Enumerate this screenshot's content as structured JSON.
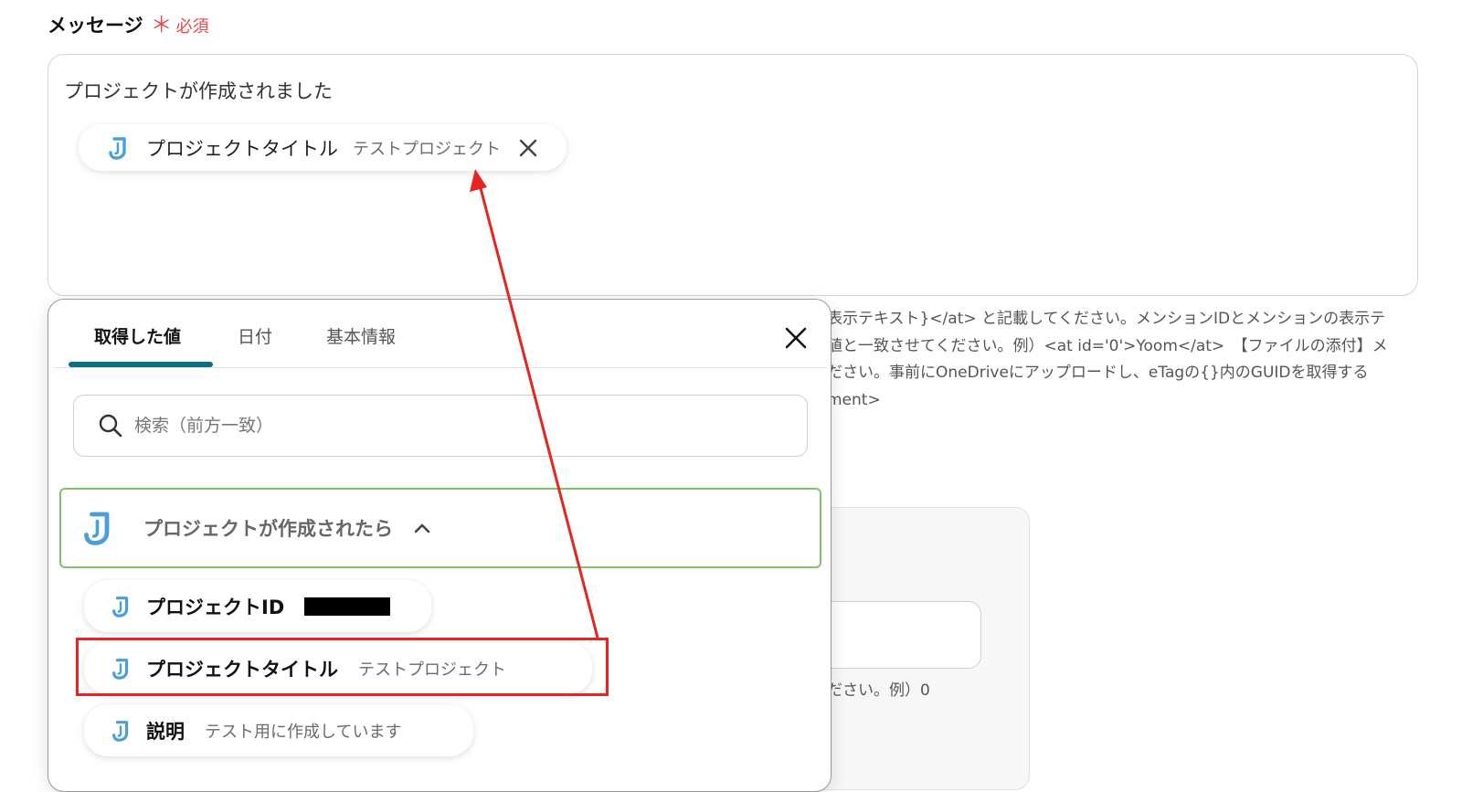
{
  "field": {
    "label": "メッセージ",
    "required_mark": "＊",
    "required_text": "必須"
  },
  "message": {
    "text": "プロジェクトが作成されました",
    "chip": {
      "title": "プロジェクトタイトル",
      "value": "テストプロジェクト",
      "icon": "jooto-logo-icon",
      "close_icon": "close-icon"
    }
  },
  "help_lines": [
    "表示テキスト}</at> と記載してください。メンションIDとメンションの表示テ",
    "値と一致させてください。例）<at id='0'>Yoom</at>　【ファイルの添付】メ",
    "ださい。事前にOneDriveにアップロードし、eTagの{}内のGUIDを取得する",
    "ment>"
  ],
  "bg_field_help": "ださい。例）0",
  "popup": {
    "tabs": [
      {
        "label": "取得した値",
        "active": true
      },
      {
        "label": "日付",
        "active": false
      },
      {
        "label": "基本情報",
        "active": false
      }
    ],
    "search_placeholder": "検索（前方一致）",
    "group": {
      "label": "プロジェクトが作成されたら",
      "expanded": true,
      "icon": "jooto-logo-icon"
    },
    "items": [
      {
        "title": "プロジェクトID",
        "value": "",
        "value_redacted": true
      },
      {
        "title": "プロジェクトタイトル",
        "value": "テストプロジェクト",
        "highlighted": true
      },
      {
        "title": "説明",
        "value": "テスト用に作成しています"
      }
    ]
  },
  "colors": {
    "accent": "#0f6f82",
    "group_border": "#7ec46b",
    "annotation": "#e52521",
    "required": "#e5484d",
    "icon_blue": "#4a9fd8"
  }
}
